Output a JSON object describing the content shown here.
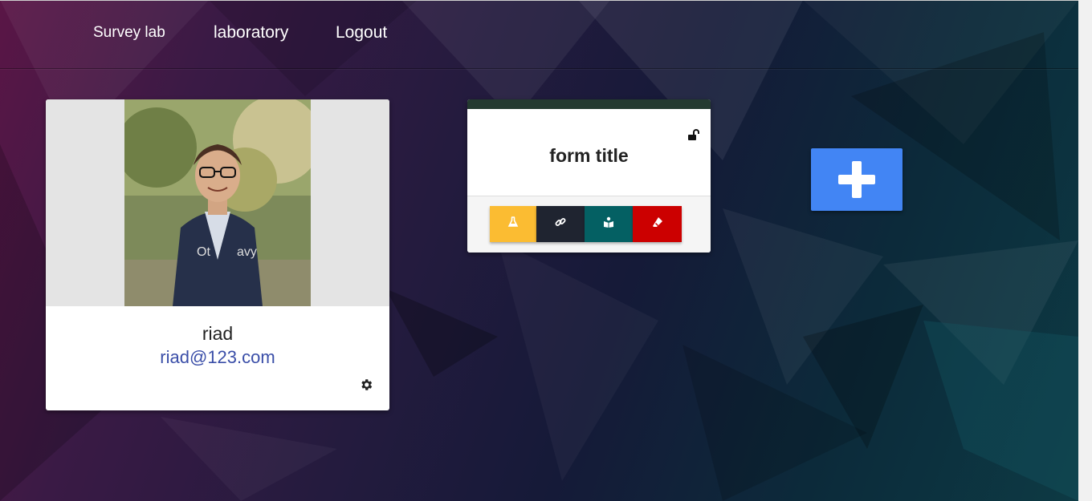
{
  "nav": {
    "brand": "Survey lab",
    "links": [
      "laboratory",
      "Logout"
    ]
  },
  "profile": {
    "name": "riad",
    "email": "riad@123.com",
    "settings_icon": "gear-icon",
    "photo": "profile-photo"
  },
  "form_card": {
    "title": "form title",
    "lock_icon": "unlock-icon",
    "actions": [
      {
        "icon": "flask-icon",
        "color": "#fbbc32"
      },
      {
        "icon": "link-icon",
        "color": "#1f2430"
      },
      {
        "icon": "reader-icon",
        "color": "#046063"
      },
      {
        "icon": "eraser-icon",
        "color": "#cc0000"
      }
    ],
    "header_color": "#243a30"
  },
  "add_button": {
    "icon": "plus-icon",
    "color": "#4285f4"
  }
}
